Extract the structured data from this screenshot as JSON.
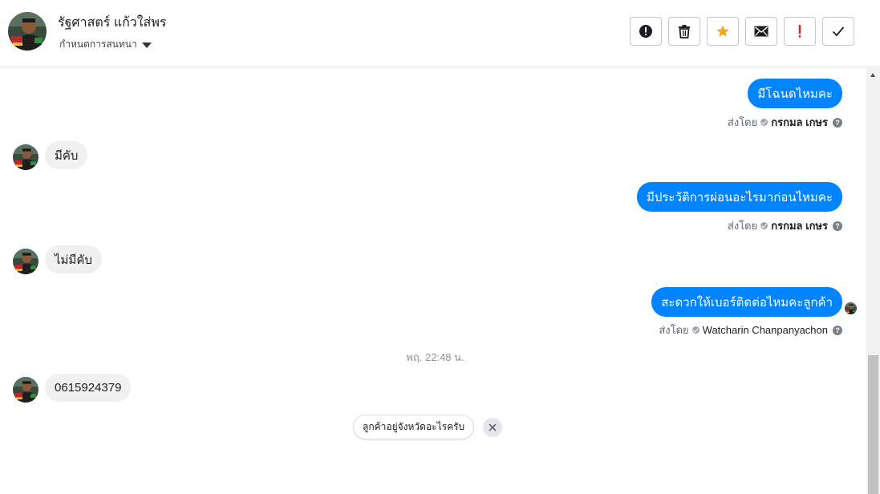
{
  "header": {
    "contact_name": "รัฐศาสตร์ แก้วใส่พร",
    "assign_label": "กำหนดการสนทนา",
    "avatar_icon": "user-photo-avatar",
    "toolbar": [
      {
        "name": "report-spam-button",
        "icon": "exclamation-circle-icon"
      },
      {
        "name": "delete-button",
        "icon": "trash-icon"
      },
      {
        "name": "star-button",
        "icon": "star-icon",
        "color": "#f5a623"
      },
      {
        "name": "mark-unread-button",
        "icon": "envelope-icon"
      },
      {
        "name": "follow-up-button",
        "icon": "exclamation-icon",
        "color": "#e02020"
      },
      {
        "name": "mark-done-button",
        "icon": "check-icon"
      }
    ]
  },
  "messages": {
    "m1": {
      "text": "มีโฉนดไหมคะ",
      "sent_by_label": "ส่งโดย",
      "sender": "กรกมล เกษร"
    },
    "m2": {
      "text": "มีคับ"
    },
    "m3": {
      "text": "มีประวัติการผ่อนอะไรมาก่อนไหมคะ",
      "sent_by_label": "ส่งโดย",
      "sender": "กรกมล เกษร"
    },
    "m4": {
      "text": "ไม่มีคับ"
    },
    "m5": {
      "text": "สะดวกให้เบอร์ติดต่อไหมคะลูกค้า",
      "sent_by_label": "ส่งโดย",
      "sender": "Watcharin Chanpanyachon"
    },
    "timestamp": "พฤ. 22:48 น.",
    "m6": {
      "text": "0615924379"
    }
  },
  "quick_reply": {
    "label": "ลูกค้าอยู่จังหวัดอะไรครับ"
  },
  "colors": {
    "outgoing_bubble": "#0084ff",
    "incoming_bubble": "#f0f0f0"
  }
}
